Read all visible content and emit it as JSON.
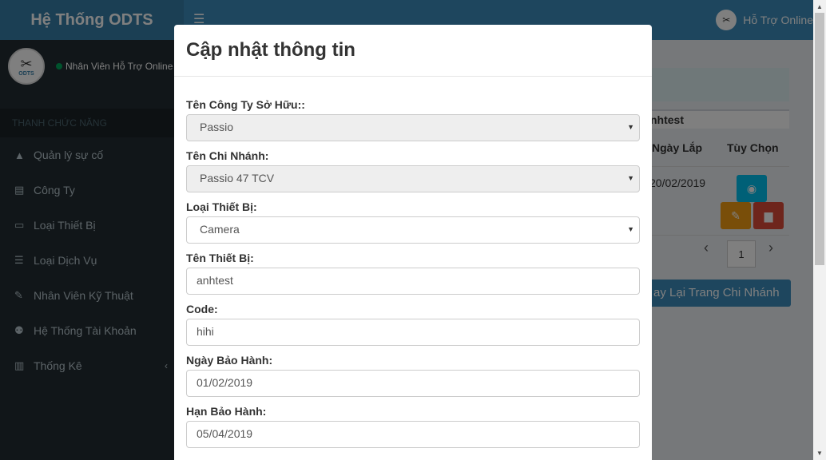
{
  "app": {
    "title": "Hệ Thống ODTS",
    "logo_text": "ODTS",
    "user_status": "Nhân Viên Hỗ Trợ Online",
    "topbar_support": "Hỗ Trợ Online"
  },
  "sidebar": {
    "header": "THANH CHỨC NĂNG",
    "items": [
      {
        "label": "Quản lý sự cố",
        "icon": "warning-icon"
      },
      {
        "label": "Công Ty",
        "icon": "building-icon"
      },
      {
        "label": "Loại Thiết Bị",
        "icon": "desktop-icon"
      },
      {
        "label": "Loại Dịch Vụ",
        "icon": "list-icon"
      },
      {
        "label": "Nhân Viên Kỹ Thuật",
        "icon": "wrench-icon"
      },
      {
        "label": "Hệ Thống Tài Khoản",
        "icon": "users-icon"
      },
      {
        "label": "Thống Kê",
        "icon": "bar-chart-icon"
      }
    ]
  },
  "background": {
    "box_title": "nhtest",
    "col_install_date": "Ngày Lắp",
    "col_options": "Tùy Chọn",
    "install_date": "20/02/2019",
    "page_number": "1",
    "back_button": "ay Lại Trang Chi Nhánh"
  },
  "modal": {
    "title": "Cập nhật thông tin",
    "fields": {
      "company": {
        "label": "Tên Công Ty Sở Hữu::",
        "value": "Passio"
      },
      "branch": {
        "label": "Tên Chi Nhánh:",
        "value": "Passio 47 TCV"
      },
      "device_type": {
        "label": "Loại Thiết Bị:",
        "value": "Camera"
      },
      "device_name": {
        "label": "Tên Thiết Bị:",
        "value": "anhtest"
      },
      "code": {
        "label": "Code:",
        "value": "hihi"
      },
      "warranty_date": {
        "label": "Ngày Bảo Hành:",
        "value": "01/02/2019"
      },
      "warranty_expiry": {
        "label": "Hạn Bảo Hành:",
        "value": "05/04/2019"
      }
    }
  },
  "colors": {
    "topbar": "#3c8dbc",
    "logo": "#367fa9",
    "sidebar": "#222d32",
    "view_button": "#00c0ef",
    "edit_button": "#f39c12",
    "delete_button": "#dd4b39"
  }
}
